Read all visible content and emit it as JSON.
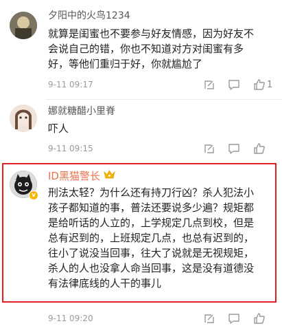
{
  "comments": [
    {
      "username": "夕阳中的火鸟1234",
      "lines": [
        "就算是闺蜜也不要参与好友情感，因为好友不",
        "会说自己的错，你也不知道对方对闺蜜有多",
        "好，等他们重归于好，你就尴尬了"
      ],
      "time": "9-11 09:17",
      "like_count": "1"
    },
    {
      "username": "娜就糖醋小里脊",
      "lines": [
        "吓人"
      ],
      "time": "9-11 09:15",
      "like_count": ""
    },
    {
      "username": "ID黑猫警长",
      "lines": [
        "刑法太轻？为什么还有持刀行凶？杀人犯法小",
        "孩子都知道的事，普法还要说多少遍？规矩都",
        "是给听话的人立的，上学规定几点到校，但是",
        "总有迟到的，上班规定几点，也总有迟到的，",
        "往小了说没当回事，往大了说就是无视规矩，",
        "杀人的人也没拿人命当回事，这是没有道德没",
        "有法律底线的人干的事儿"
      ],
      "time": "9-11 09:20",
      "like_count": ""
    }
  ],
  "icons": {
    "reply": "reply-icon",
    "comment": "comment-icon",
    "like": "like-icon",
    "crown": "crown-icon",
    "verified": "verified-badge-icon"
  },
  "colors": {
    "highlight_border": "#e01e24",
    "vip_name": "#eb7350"
  }
}
